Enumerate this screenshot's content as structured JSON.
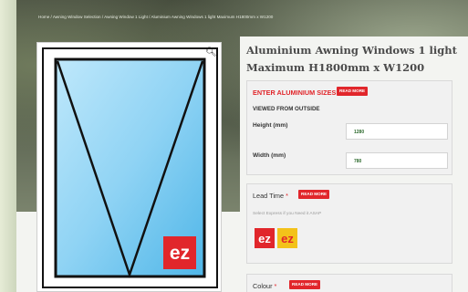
{
  "breadcrumb": "Home / Awning Window Selection / Awning Window 1 Light / Aluminium Awning Windows 1 light Maximum H1800mm x W1200",
  "product": {
    "title": "Aluminium Awning Windows 1 light Maximum H1800mm x W1200"
  },
  "sizes": {
    "heading": "ENTER ALUMINIUM SIZES",
    "read_more": "READ MORE",
    "viewed": "VIEWED FROM OUTSIDE",
    "height_label": "Height (mm)",
    "height_value": "1280",
    "width_label": "Width (mm)",
    "width_value": "780"
  },
  "lead_time": {
    "label": "Lead Time",
    "required_mark": "*",
    "read_more": "READ MORE",
    "hint": "Select Express if you Need it ASAP"
  },
  "colour": {
    "label": "Colour",
    "required_mark": "*",
    "read_more": "READ MORE"
  },
  "icons": {
    "zoom": "magnifier-icon",
    "brand": "ez-logo"
  },
  "colors": {
    "accent_red": "#e1262b",
    "express_yellow": "#f3c21a",
    "glass_blue": "#8fd3f4"
  }
}
